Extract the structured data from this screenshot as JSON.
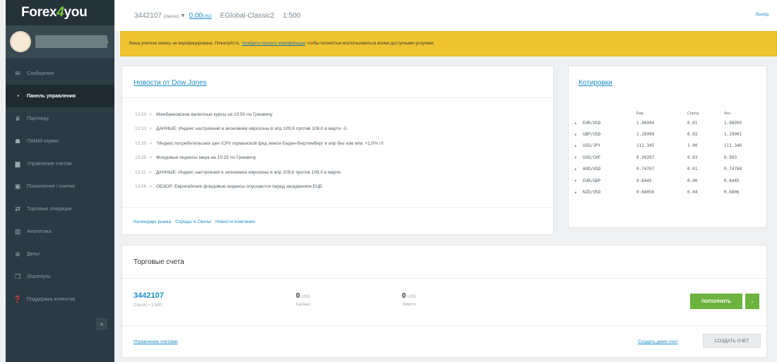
{
  "brand": {
    "name_pre": "Forex",
    "name_accent": "4",
    "name_post": "you"
  },
  "topbar": {
    "account": "3442107",
    "account_type": "(classic)",
    "caret": "▾",
    "balance": "0.00",
    "balance_currency": "USD",
    "server": "EGlobal-Classic2",
    "leverage": "1:500",
    "logout": "Выход"
  },
  "alert": {
    "text_before": "Ваша учетная запись не верифицирована. Пожалуйста,",
    "link": "пройдите процесс верификации",
    "text_after": "чтобы полностью воспользоваться всеми доступными услугами."
  },
  "sidebar": {
    "items": [
      {
        "label": "Сообщения",
        "icon": "envelope-icon",
        "glyph": "✉"
      },
      {
        "label": "Панель управления",
        "icon": "dashboard-icon",
        "glyph": "◔"
      },
      {
        "label": "Партнеру",
        "icon": "partner-icon",
        "glyph": "♛"
      },
      {
        "label": "ПАММ-сервис",
        "icon": "users-icon",
        "glyph": "☗"
      },
      {
        "label": "Управление счетом",
        "icon": "briefcase-icon",
        "glyph": "▆"
      },
      {
        "label": "Пополнение / снятие",
        "icon": "card-icon",
        "glyph": "▣"
      },
      {
        "label": "Торговые операции",
        "icon": "exchange-icon",
        "glyph": "⇄"
      },
      {
        "label": "Аналитика",
        "icon": "chart-icon",
        "glyph": "▥"
      },
      {
        "label": "Деньг",
        "icon": "plus-circle-icon",
        "glyph": "⊕"
      },
      {
        "label": "Share4you",
        "icon": "copy-icon",
        "glyph": "❐"
      },
      {
        "label": "Поддержка клиентов",
        "icon": "question-icon",
        "glyph": "❓"
      }
    ],
    "collapse": "«"
  },
  "news": {
    "title": "Новости от Dow Jones",
    "items": [
      {
        "time": "13:50",
        "text": "Межбанковские валютные курсы на 10:50 по Гринвичу"
      },
      {
        "time": "13:33",
        "text": "ДАННЫЕ: Индекс настроений в экономике еврозоны в апр 109,6 против 108,0 в марте -2-"
      },
      {
        "time": "13:30",
        "text": "*Индекс потребительских цен /CPI/ германской фед земли Баден-Вюртемберг в апр без изм м/м, +2,0% г/г"
      },
      {
        "time": "13:25",
        "text": "Фондовые индексы мира на 10:25 по Гринвичу"
      },
      {
        "time": "13:11",
        "text": "ДАННЫЕ: Индекс настроений в экономике еврозоны в апр 109,6 против 108,0 в марте"
      },
      {
        "time": "13:06",
        "text": "ОБЗОР: Европейские фондовые индексы опускаются перед заседанием ЕЦБ"
      }
    ],
    "arrow": ">",
    "footer_links": [
      "Календарь рынка",
      "Спреды и Свопы",
      "Новости компании"
    ]
  },
  "quotes": {
    "title": "Котировки",
    "headers": {
      "bid": "Бид",
      "spread": "Спред",
      "ask": "Аск"
    },
    "rows": [
      {
        "symbol": "EUR/USD",
        "bid": "1.08994",
        "spread": "0.01",
        "ask": "1.08995",
        "dir": "up"
      },
      {
        "symbol": "GBP/USD",
        "bid": "1.28999",
        "spread": "0.02",
        "ask": "1.29001",
        "dir": "up"
      },
      {
        "symbol": "USD/JPY",
        "bid": "111.345",
        "spread": "1.00",
        "ask": "111.346",
        "dir": "up"
      },
      {
        "symbol": "USD/CHF",
        "bid": "0.99297",
        "spread": "0.03",
        "ask": "0.993",
        "dir": "down"
      },
      {
        "symbol": "AUD/USD",
        "bid": "0.74767",
        "spread": "0.01",
        "ask": "0.74768",
        "dir": "up"
      },
      {
        "symbol": "EUR/GBP",
        "bid": "0.8445",
        "spread": "0.00",
        "ask": "0.8445",
        "dir": "down"
      },
      {
        "symbol": "NZD/USD",
        "bid": "0.68056",
        "spread": "0.04",
        "ask": "0.6806",
        "dir": "up"
      }
    ],
    "up_glyph": "▴",
    "down_glyph": "▾"
  },
  "accounts": {
    "title": "Торговые счета",
    "number": "3442107",
    "sub": "Classic • 1:500",
    "balance_value": "0",
    "balance_unit": "USD",
    "balance_label": "Баланс",
    "equity_value": "0",
    "equity_unit": "USD",
    "equity_label": "Эквити",
    "fund_button": "пополнить",
    "dropdown_glyph": "⌄",
    "manage_link": "Управление счетами",
    "demo_link": "Создать демо счет",
    "create_button": "создать счет"
  },
  "colors": {
    "accent": "#1c8ec9",
    "green": "#7cc242",
    "red": "#d22d4f",
    "alert": "#f0c430",
    "sidebar": "#2c3a44"
  }
}
